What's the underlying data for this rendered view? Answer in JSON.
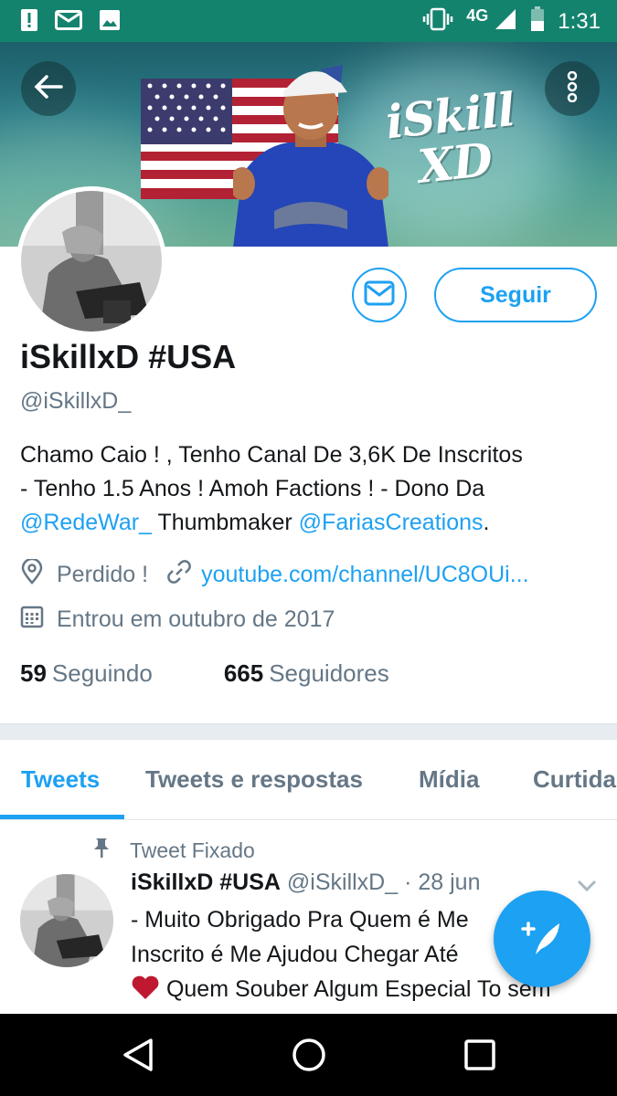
{
  "status_bar": {
    "network": "4G",
    "time": "1:31"
  },
  "banner": {
    "text_line1": "iSkill",
    "text_line2": "XD"
  },
  "profile": {
    "display_name": "iSkillxD #USA",
    "handle": "@iSkillxD_",
    "follow_label": "Seguir",
    "bio": {
      "line1": "Chamo Caio ! , Tenho Canal De 3,6K De Inscritos",
      "line2": "- Tenho 1.5 Anos ! Amoh Factions ! - Dono Da",
      "mention1": "@RedeWar_",
      "mid_text": " Thumbmaker ",
      "mention2": "@FariasCreations",
      "end": "."
    },
    "location": "Perdido !",
    "website": "youtube.com/channel/UC8OUi...",
    "joined": "Entrou em outubro de 2017",
    "following_count": "59",
    "following_label": "Seguindo",
    "followers_count": "665",
    "followers_label": "Seguidores"
  },
  "tabs": [
    {
      "label": "Tweets"
    },
    {
      "label": "Tweets e respostas"
    },
    {
      "label": "Mídia"
    },
    {
      "label": "Curtida"
    }
  ],
  "tweet": {
    "pinned_label": "Tweet Fixado",
    "author_name": "iSkillxD #USA",
    "author_handle": "@iSkillxD_",
    "date": "· 28 jun",
    "line1": "- Muito Obrigado Pra Quem é Me",
    "line2": "Inscrito é Me Ajudou Chegar Até",
    "line3": " Quem Souber Algum Especial To sem"
  },
  "colors": {
    "accent": "#1da1f2",
    "status_bar": "#14836e"
  }
}
